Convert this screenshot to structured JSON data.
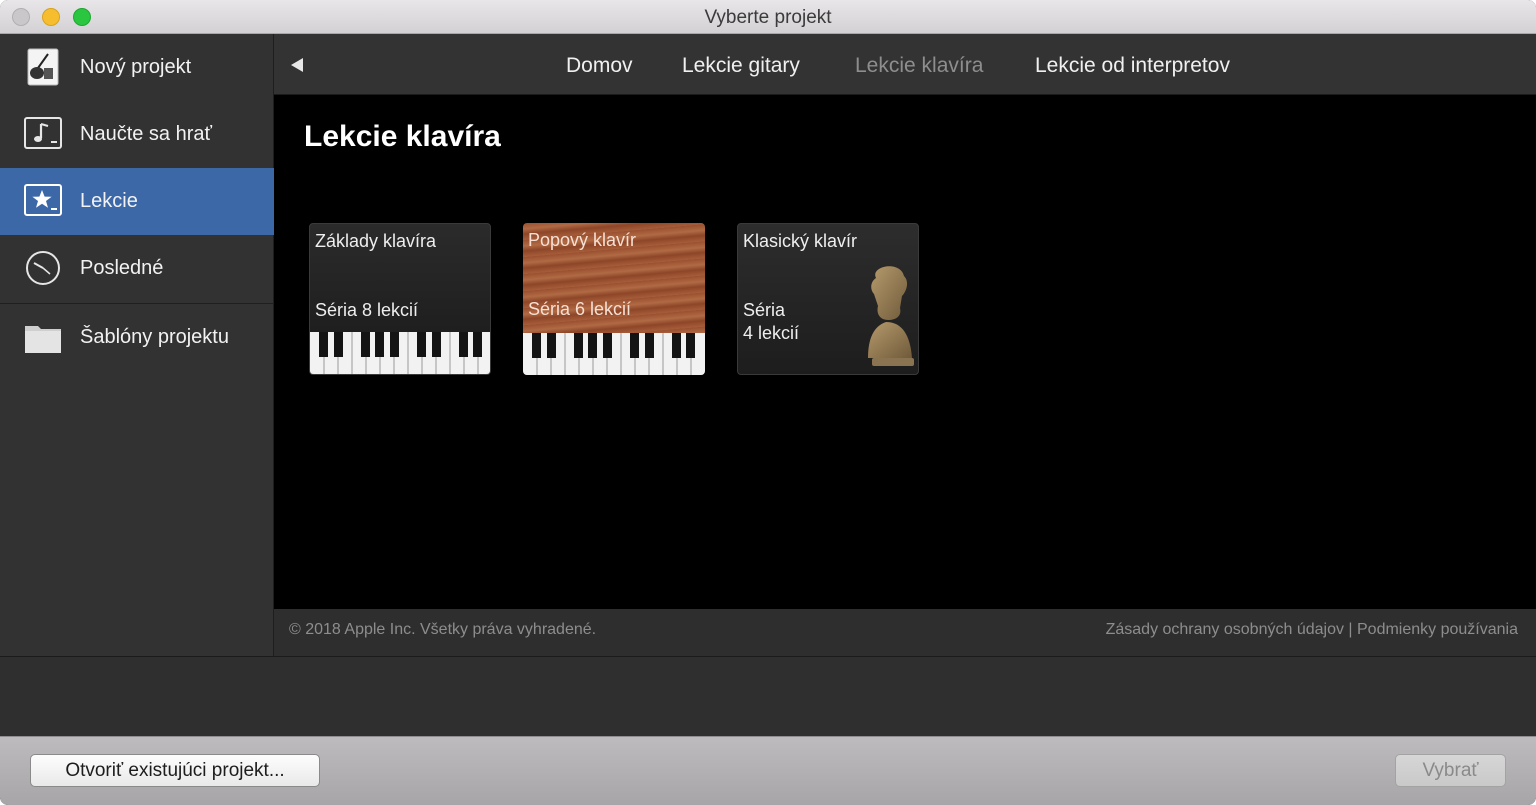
{
  "window": {
    "title": "Vyberte projekt"
  },
  "sidebar": {
    "items": [
      {
        "label": "Nový projekt",
        "icon": "guitar-document-icon"
      },
      {
        "label": "Naučte sa hrať",
        "icon": "music-note-icon"
      },
      {
        "label": "Lekcie",
        "icon": "star-icon"
      },
      {
        "label": "Posledné",
        "icon": "clock-icon"
      },
      {
        "label": "Šablóny projektu",
        "icon": "folder-icon"
      }
    ],
    "active_index": 2
  },
  "nav": {
    "back_icon": "back-triangle-icon",
    "tabs": [
      {
        "label": "Domov"
      },
      {
        "label": "Lekcie gitary"
      },
      {
        "label": "Lekcie klavíra"
      },
      {
        "label": "Lekcie od interpretov"
      }
    ],
    "current_index": 2
  },
  "main": {
    "heading": "Lekcie klavíra",
    "cards": [
      {
        "title": "Základy klavíra",
        "subtitle": "Séria 8 lekcií"
      },
      {
        "title": "Popový klavír",
        "subtitle": "Séria 6 lekcií"
      },
      {
        "title": "Klasický klavír",
        "subtitle_line1": "Séria",
        "subtitle_line2": "4 lekcií"
      }
    ]
  },
  "footer": {
    "copyright": "© 2018 Apple Inc. Všetky práva vyhradené.",
    "links": "Zásady ochrany osobných údajov | Podmienky používania"
  },
  "buttons": {
    "open": "Otvoriť existujúci projekt...",
    "choose": "Vybrať"
  },
  "colors": {
    "sidebar_active": "#3d68a8",
    "sidebar_bg": "#323232",
    "content_bg": "#000000"
  }
}
